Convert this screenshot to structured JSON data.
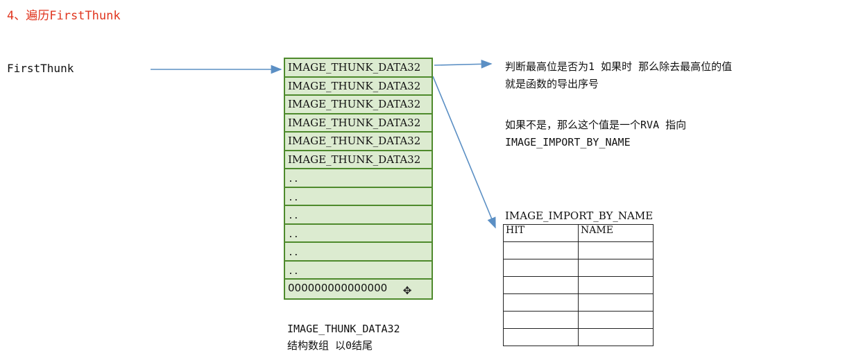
{
  "heading": "4、遍历FirstThunk",
  "left_label": "FirstThunk",
  "thunk_array": {
    "rows": [
      {
        "text": "IMAGE_THUNK_DATA32",
        "kind": "entry"
      },
      {
        "text": "IMAGE_THUNK_DATA32",
        "kind": "entry"
      },
      {
        "text": "IMAGE_THUNK_DATA32",
        "kind": "entry"
      },
      {
        "text": "IMAGE_THUNK_DATA32",
        "kind": "entry"
      },
      {
        "text": "IMAGE_THUNK_DATA32",
        "kind": "entry"
      },
      {
        "text": "IMAGE_THUNK_DATA32",
        "kind": "entry"
      },
      {
        "text": "..",
        "kind": "dots"
      },
      {
        "text": "..",
        "kind": "dots"
      },
      {
        "text": "..",
        "kind": "dots"
      },
      {
        "text": "..",
        "kind": "dots"
      },
      {
        "text": "..",
        "kind": "dots"
      },
      {
        "text": "..",
        "kind": "dots"
      },
      {
        "text": "000000000000000",
        "kind": "zero"
      }
    ],
    "caption_line1": "IMAGE_THUNK_DATA32",
    "caption_line2": "结构数组 以0结尾"
  },
  "note": {
    "line1": "判断最高位是否为1 如果时 那么除去最高位的值",
    "line2": "就是函数的导出序号",
    "line3": "如果不是，那么这个值是一个RVA 指向",
    "line4": "IMAGE_IMPORT_BY_NAME"
  },
  "import_by_name": {
    "title": "IMAGE_IMPORT_BY_NAME",
    "columns": [
      "HIT",
      "NAME"
    ],
    "empty_rows": 6
  },
  "colors": {
    "heading": "#e0351f",
    "table_fill": "#dcebd0",
    "table_border": "#4e8a2c",
    "arrow": "#5b8fc4"
  }
}
